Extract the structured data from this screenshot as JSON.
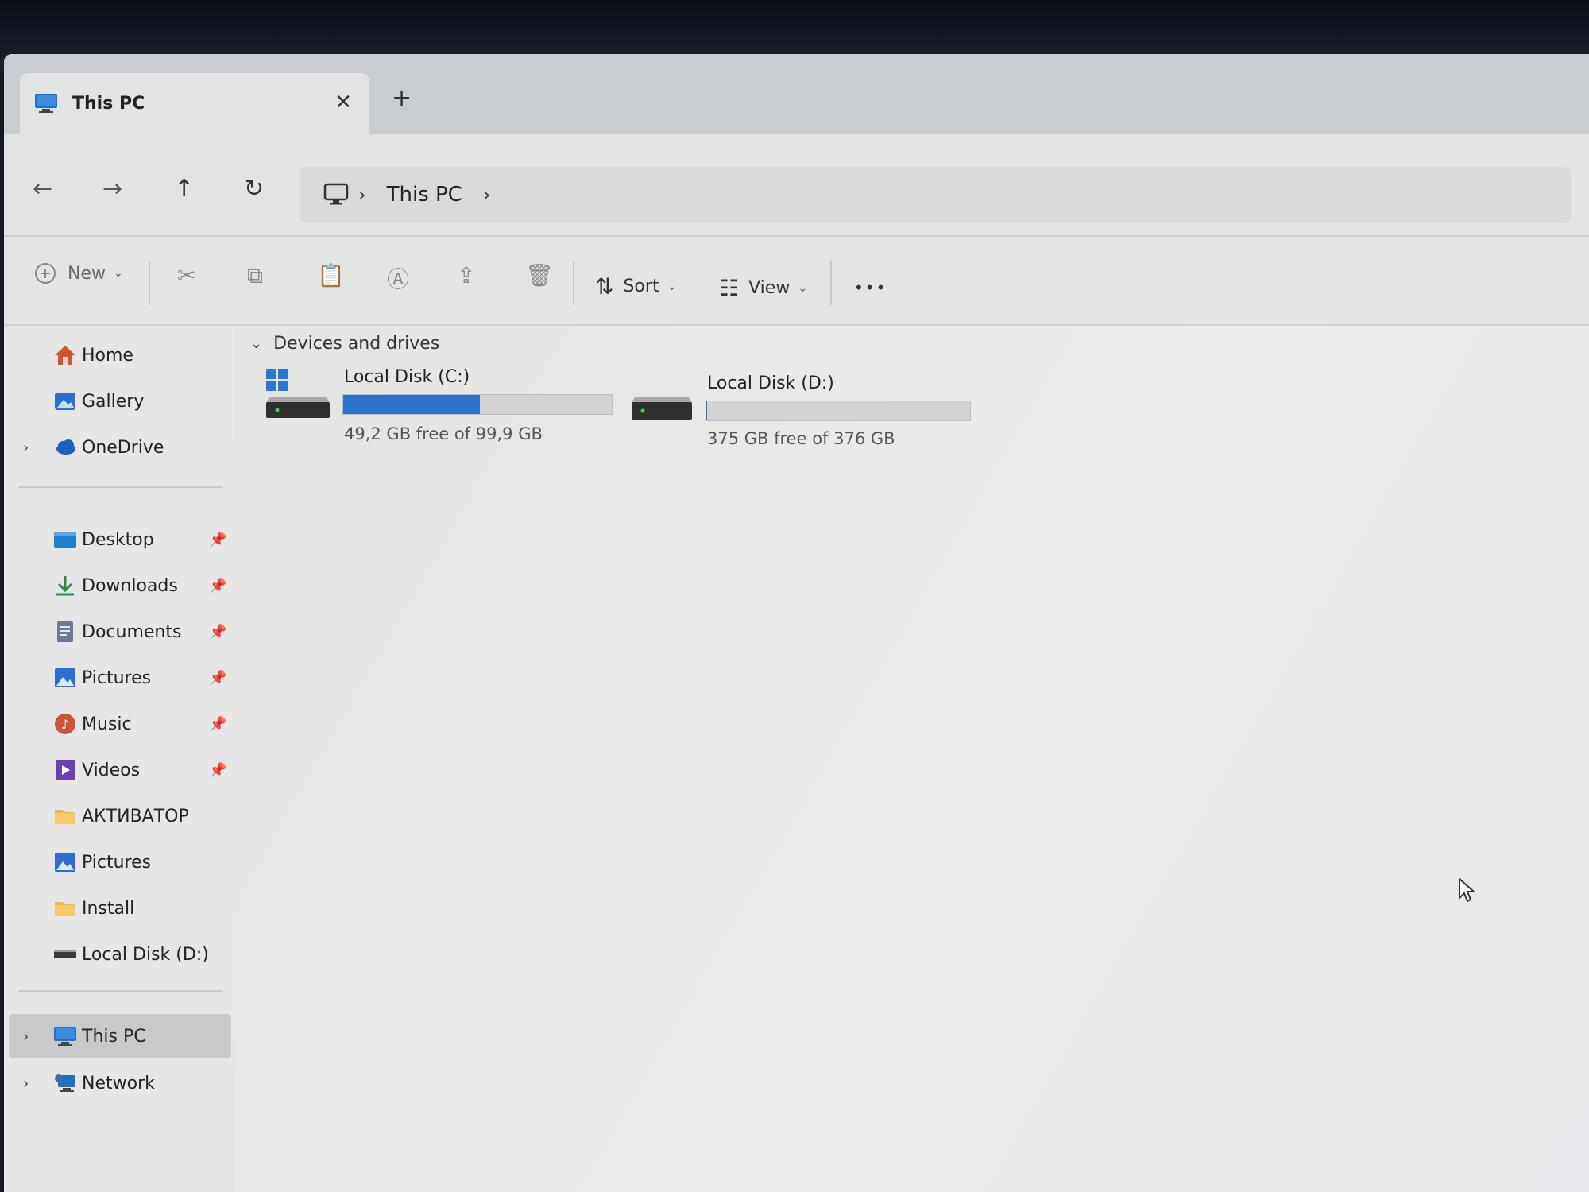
{
  "tab": {
    "title": "This PC",
    "close": "✕",
    "new": "+"
  },
  "nav": {
    "back": "←",
    "forward": "→",
    "up": "↑",
    "refresh": "↻"
  },
  "address": {
    "segments": [
      "This PC"
    ],
    "chevron": "›"
  },
  "toolbar": {
    "new_label": "New",
    "sort_label": "Sort",
    "view_label": "View",
    "more": "•••",
    "caret": "⌄"
  },
  "sidebar": {
    "top": [
      {
        "label": "Home",
        "icon": "home-icon",
        "color": "#d0552e"
      },
      {
        "label": "Gallery",
        "icon": "gallery-icon",
        "color": "#2c6fd1"
      },
      {
        "label": "OneDrive",
        "icon": "cloud-icon",
        "color": "#1f5fbf",
        "expandable": true
      }
    ],
    "quick": [
      {
        "label": "Desktop",
        "icon": "desktop-icon",
        "color": "#1f7fcf",
        "pinned": true
      },
      {
        "label": "Downloads",
        "icon": "download-icon",
        "color": "#2b8a4a",
        "pinned": true
      },
      {
        "label": "Documents",
        "icon": "document-icon",
        "color": "#6b7a90",
        "pinned": true
      },
      {
        "label": "Pictures",
        "icon": "pictures-icon",
        "color": "#2c6fd1",
        "pinned": true
      },
      {
        "label": "Music",
        "icon": "music-icon",
        "color": "#c9553a",
        "pinned": true
      },
      {
        "label": "Videos",
        "icon": "video-icon",
        "color": "#6a3fb0",
        "pinned": true
      },
      {
        "label": "АКТИВАТОР",
        "icon": "folder-icon",
        "color": "#e6b94a"
      },
      {
        "label": "Pictures",
        "icon": "pictures-icon",
        "color": "#2c6fd1"
      },
      {
        "label": "Install",
        "icon": "folder-icon",
        "color": "#e6b94a"
      },
      {
        "label": "Local Disk (D:)",
        "icon": "drive-icon",
        "color": "#3a3a3a"
      }
    ],
    "bottom": [
      {
        "label": "This PC",
        "icon": "computer-icon",
        "color": "#1f6fc4",
        "selected": true
      },
      {
        "label": "Network",
        "icon": "network-icon",
        "color": "#1f6fc4"
      }
    ],
    "pin_glyph": "📌",
    "expand_glyph": "›"
  },
  "content": {
    "group_label": "Devices and drives",
    "group_chevron": "⌄",
    "drives": [
      {
        "name": "Local Disk (C:)",
        "free_text": "49,2 GB free of 99,9 GB",
        "used_fraction": 0.51,
        "system": true
      },
      {
        "name": "Local Disk (D:)",
        "free_text": "375 GB free of 376 GB",
        "used_fraction": 0.003,
        "system": false
      }
    ]
  },
  "colors": {
    "accent": "#2a73c9",
    "selected_bg": "#c8c9ca"
  }
}
